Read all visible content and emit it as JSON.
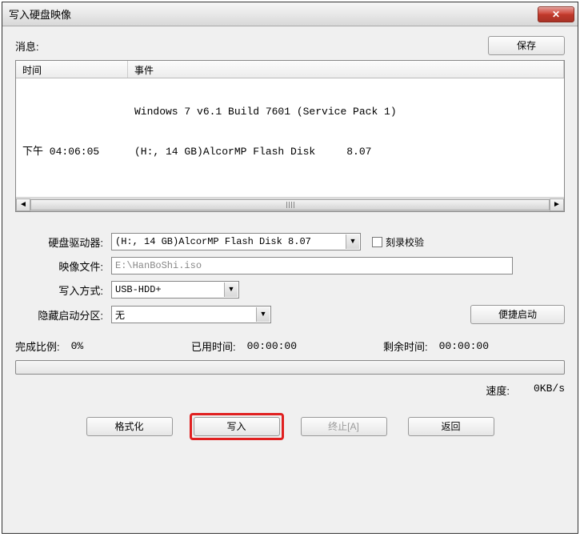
{
  "window": {
    "title": "写入硬盘映像",
    "close_glyph": "✕"
  },
  "messages": {
    "label": "消息:",
    "save_button": "保存",
    "columns": {
      "time": "时间",
      "event": "事件"
    },
    "rows": [
      {
        "time": "",
        "event": "Windows 7 v6.1 Build 7601 (Service Pack 1)"
      },
      {
        "time": "下午 04:06:05",
        "event": "(H:, 14 GB)AlcorMP Flash Disk     8.07"
      }
    ]
  },
  "form": {
    "drive_label": "硬盘驱动器:",
    "drive_value": "(H:, 14 GB)AlcorMP Flash Disk     8.07",
    "verify_label": "刻录校验",
    "verify_checked": false,
    "image_label": "映像文件:",
    "image_value": "E:\\HanBoShi.iso",
    "write_mode_label": "写入方式:",
    "write_mode_value": "USB-HDD+",
    "hide_boot_label": "隐藏启动分区:",
    "hide_boot_value": "无",
    "quick_boot_button": "便捷启动"
  },
  "progress": {
    "done_label": "完成比例:",
    "done_value": "0%",
    "elapsed_label": "已用时间:",
    "elapsed_value": "00:00:00",
    "remain_label": "剩余时间:",
    "remain_value": "00:00:00",
    "speed_label": "速度:",
    "speed_value": "0KB/s"
  },
  "buttons": {
    "format": "格式化",
    "write": "写入",
    "abort": "终止[A]",
    "back": "返回"
  },
  "scroll": {
    "left": "◄",
    "right": "►"
  }
}
